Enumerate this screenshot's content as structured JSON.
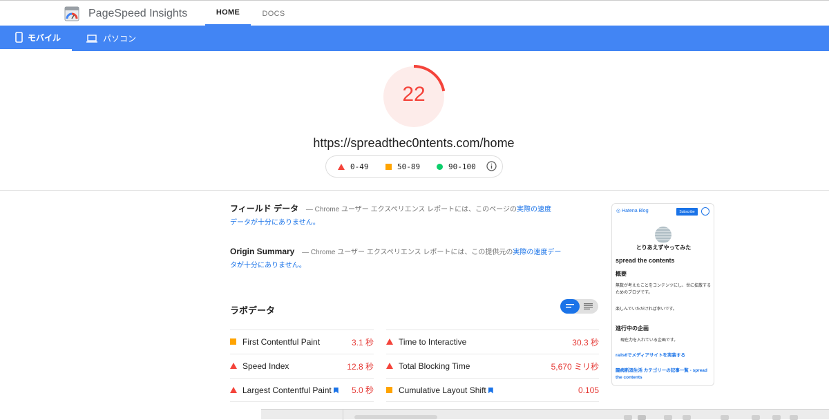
{
  "app": {
    "name": "PageSpeed Insights"
  },
  "nav": {
    "home": "HOME",
    "docs": "DOCS"
  },
  "devices": {
    "mobile": "モバイル",
    "desktop": "パソコン"
  },
  "score": {
    "value": "22",
    "fraction": 0.22,
    "color": "#f4433a"
  },
  "url": "https://spreadthec0ntents.com/home",
  "legend": {
    "poor": "0-49",
    "average": "50-89",
    "good": "90-100"
  },
  "field": {
    "title": "フィールド データ",
    "text": " — Chrome ユーザー エクスペリエンス レポートには、このページの",
    "link1": "実際の速度",
    "link2": "データが十分にありません。"
  },
  "origin": {
    "title": "Origin Summary",
    "text": " — Chrome ユーザー エクスペリエンス レポートには、この提供元の",
    "link1": "実際の速度デー",
    "link2": "タが十分にありません。"
  },
  "lab": {
    "title": "ラボデータ",
    "metrics": [
      {
        "name": "First Contentful Paint",
        "value": "3.1 秒",
        "status": "average"
      },
      {
        "name": "Time to Interactive",
        "value": "30.3 秒",
        "status": "poor"
      },
      {
        "name": "Speed Index",
        "value": "12.8 秒",
        "status": "poor"
      },
      {
        "name": "Total Blocking Time",
        "value": "5,670 ミリ秒",
        "status": "poor"
      },
      {
        "name": "Largest Contentful Paint",
        "value": "5.0 秒",
        "status": "poor"
      },
      {
        "name": "Cumulative Layout Shift",
        "value": "0.105",
        "status": "average"
      }
    ]
  },
  "thumb": {
    "blog": "Hatena Blog",
    "subscribe": "Subscribe",
    "blog_title": "とりあえずやってみた",
    "site": "spread the contents",
    "overview": "概要",
    "desc1": "無数が考えたことをコンテンツにし、世に拡散するためのブログです。",
    "desc2": "楽しんでいただければ幸いです。",
    "projects": "進行中の企画",
    "proj_text": "現在力を入れている企画です。",
    "link1": "rails6でメディアサイトを実装する",
    "link2": "闘病断酒生活 カテゴリーの記事一覧 - spread the contents"
  },
  "colors": {
    "accent": "#4285f4",
    "poor": "#f4433a",
    "average": "#ffa400",
    "good": "#0cce6b",
    "link": "#1a73e8"
  }
}
